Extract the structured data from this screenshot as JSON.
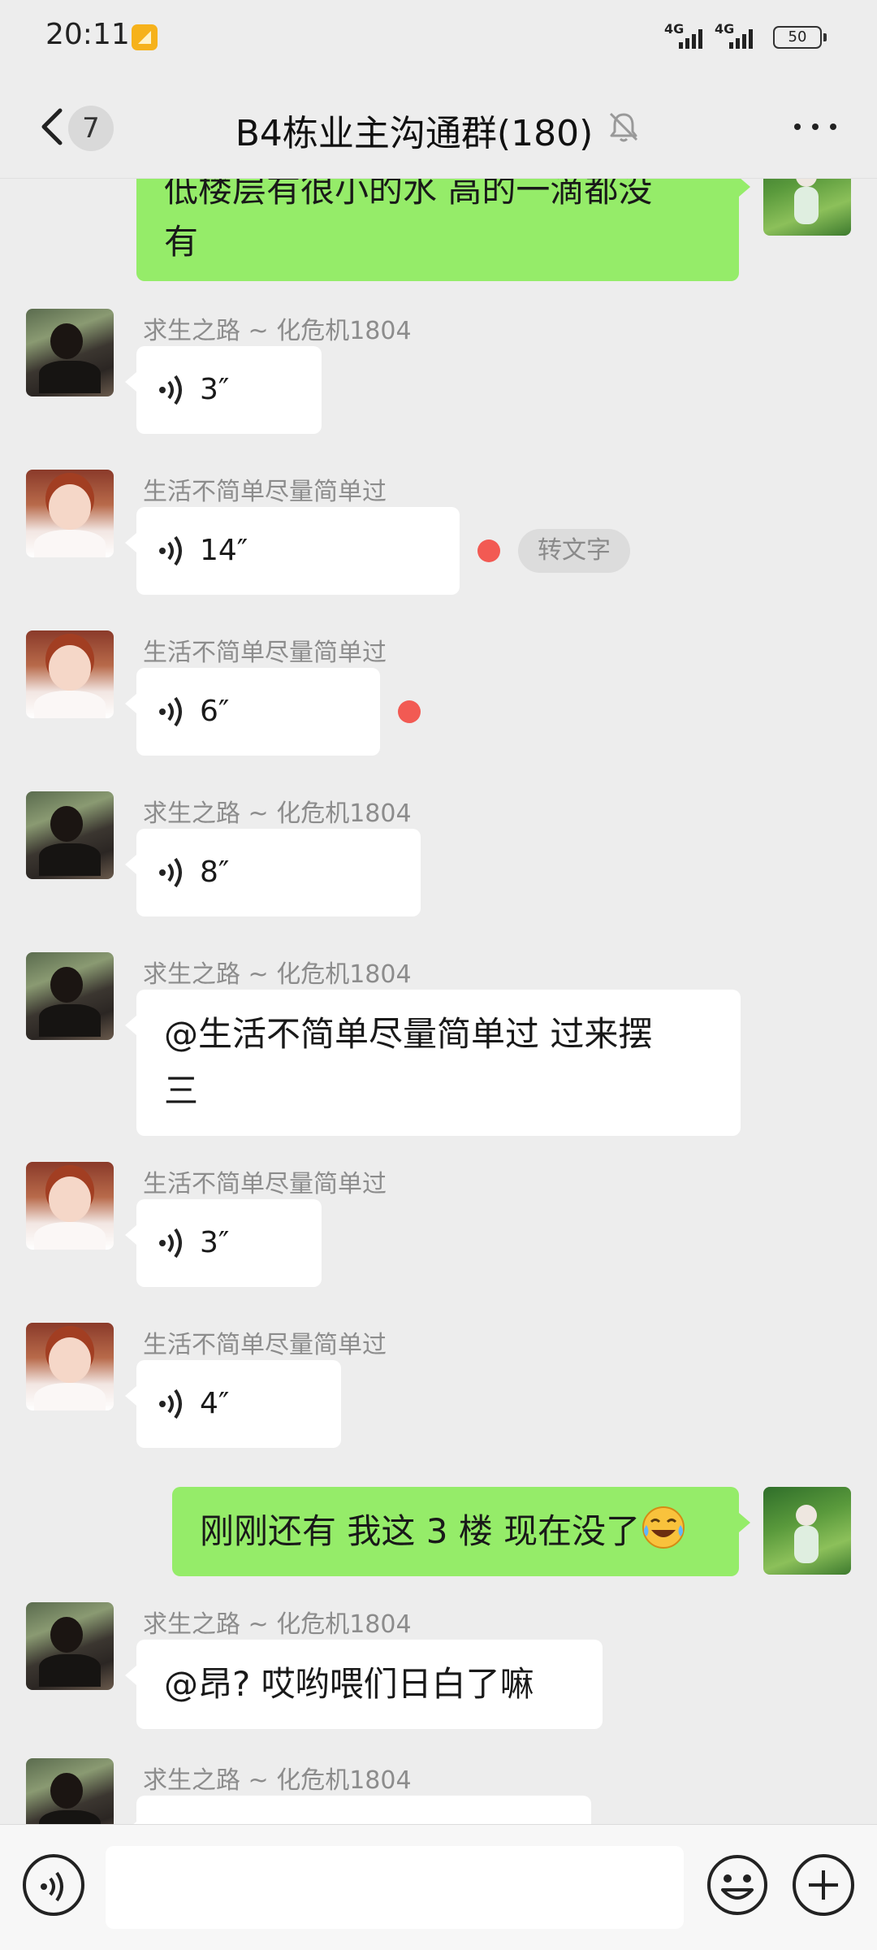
{
  "status_bar": {
    "time": "20:11",
    "network_1": "4G",
    "network_2": "4G",
    "battery": "50"
  },
  "header": {
    "unread_count": "7",
    "title": "B4栋业主沟通群(180)"
  },
  "messages": [
    {
      "type": "text",
      "side": "out",
      "text_line1": "低楼层有很小的水 高的一滴都没",
      "text_line2": "有"
    },
    {
      "type": "voice",
      "side": "in",
      "sender": "求生之路 ~ 化危机1804",
      "duration": "3″"
    },
    {
      "type": "voice",
      "side": "in",
      "sender": "生活不简单尽量简单过",
      "duration": "14″",
      "unread": true,
      "convert_label": "转文字"
    },
    {
      "type": "voice",
      "side": "in",
      "sender": "生活不简单尽量简单过",
      "duration": "6″",
      "unread": true
    },
    {
      "type": "voice",
      "side": "in",
      "sender": "求生之路 ~ 化危机1804",
      "duration": "8″"
    },
    {
      "type": "text",
      "side": "in",
      "sender": "求生之路 ~ 化危机1804",
      "text_line1": "@生活不简单尽量简单过  过来摆",
      "text_line2": "三"
    },
    {
      "type": "voice",
      "side": "in",
      "sender": "生活不简单尽量简单过",
      "duration": "3″"
    },
    {
      "type": "voice",
      "side": "in",
      "sender": "生活不简单尽量简单过",
      "duration": "4″"
    },
    {
      "type": "text",
      "side": "out",
      "text": "刚刚还有 我这 3 楼 现在没了",
      "emoji": "laugh-cry-emoji"
    },
    {
      "type": "text",
      "side": "in",
      "sender": "求生之路 ~ 化危机1804",
      "text": "@昂?  哎哟喂们日白了嘛"
    },
    {
      "type": "text",
      "side": "in",
      "sender": "求生之路 ~ 化危机1804",
      "text": ""
    }
  ],
  "input_bar": {
    "icons": [
      "voice-mode-icon",
      "emoji-icon",
      "plus-icon"
    ]
  },
  "colors": {
    "background": "#ededed",
    "bubble_out": "#95ec69",
    "bubble_in": "#ffffff",
    "unread_dot": "#f25a53",
    "sender_name": "#8c8c8c"
  }
}
